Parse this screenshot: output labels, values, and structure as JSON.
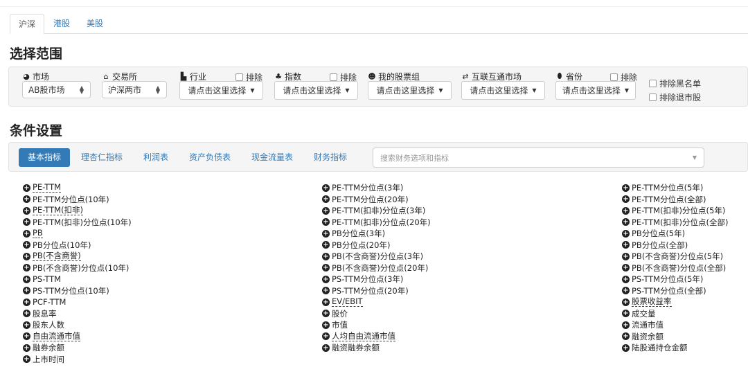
{
  "market_tabs": [
    {
      "label": "沪深",
      "active": true
    },
    {
      "label": "港股",
      "active": false
    },
    {
      "label": "美股",
      "active": false
    }
  ],
  "scope": {
    "title": "选择范围",
    "market": {
      "label": "市场",
      "icon": "globe-icon",
      "value": "AB股市场"
    },
    "exchange": {
      "label": "交易所",
      "icon": "bank-icon",
      "value": "沪深两市"
    },
    "industry": {
      "label": "行业",
      "icon": "factory-icon",
      "exclude": "排除",
      "button": "请点击这里选择"
    },
    "index": {
      "label": "指数",
      "icon": "cubes-icon",
      "exclude": "排除",
      "button": "请点击这里选择"
    },
    "portfolio": {
      "label": "我的股票组",
      "icon": "users-icon",
      "button": "请点击这里选择"
    },
    "connect": {
      "label": "互联互通市场",
      "icon": "exchange-icon",
      "button": "请点击这里选择"
    },
    "province": {
      "label": "省份",
      "icon": "map-marker-icon",
      "exclude": "排除",
      "button": "请点击这里选择"
    },
    "blacklist": "排除黑名单",
    "delisted": "排除退市股"
  },
  "conditions": {
    "title": "条件设置",
    "tabs": [
      {
        "label": "基本指标",
        "active": true
      },
      {
        "label": "理杏仁指标",
        "active": false
      },
      {
        "label": "利润表",
        "active": false
      },
      {
        "label": "资产负债表",
        "active": false
      },
      {
        "label": "现金流量表",
        "active": false
      },
      {
        "label": "财务指标",
        "active": false
      }
    ],
    "search_placeholder": "搜索财务选项和指标"
  },
  "indicators": {
    "col1": [
      {
        "label": "PE-TTM",
        "u": true
      },
      {
        "label": "PE-TTM分位点(10年)",
        "u": false
      },
      {
        "label": "PE-TTM(扣非)",
        "u": true
      },
      {
        "label": "PE-TTM(扣非)分位点(10年)",
        "u": false
      },
      {
        "label": "PB",
        "u": true
      },
      {
        "label": "PB分位点(10年)",
        "u": false
      },
      {
        "label": "PB(不含商誉)",
        "u": true
      },
      {
        "label": "PB(不含商誉)分位点(10年)",
        "u": false
      },
      {
        "label": "PS-TTM",
        "u": false
      },
      {
        "label": "PS-TTM分位点(10年)",
        "u": false
      },
      {
        "label": "PCF-TTM",
        "u": false
      },
      {
        "label": "股息率",
        "u": false
      },
      {
        "label": "股东人数",
        "u": false
      },
      {
        "label": "自由流通市值",
        "u": true
      },
      {
        "label": "融券余额",
        "u": false
      },
      {
        "label": "上市时间",
        "u": false
      }
    ],
    "col2": [
      {
        "label": "PE-TTM分位点(3年)",
        "u": false
      },
      {
        "label": "PE-TTM分位点(20年)",
        "u": false
      },
      {
        "label": "PE-TTM(扣非)分位点(3年)",
        "u": false
      },
      {
        "label": "PE-TTM(扣非)分位点(20年)",
        "u": false
      },
      {
        "label": "PB分位点(3年)",
        "u": false
      },
      {
        "label": "PB分位点(20年)",
        "u": false
      },
      {
        "label": "PB(不含商誉)分位点(3年)",
        "u": false
      },
      {
        "label": "PB(不含商誉)分位点(20年)",
        "u": false
      },
      {
        "label": "PS-TTM分位点(3年)",
        "u": false
      },
      {
        "label": "PS-TTM分位点(20年)",
        "u": false
      },
      {
        "label": "EV/EBIT",
        "u": true
      },
      {
        "label": "股价",
        "u": false
      },
      {
        "label": "市值",
        "u": false
      },
      {
        "label": "人均自由流通市值",
        "u": true
      },
      {
        "label": "融资融券余额",
        "u": false
      }
    ],
    "col3": [
      {
        "label": "PE-TTM分位点(5年)",
        "u": false
      },
      {
        "label": "PE-TTM分位点(全部)",
        "u": false
      },
      {
        "label": "PE-TTM(扣非)分位点(5年)",
        "u": false
      },
      {
        "label": "PE-TTM(扣非)分位点(全部)",
        "u": false
      },
      {
        "label": "PB分位点(5年)",
        "u": false
      },
      {
        "label": "PB分位点(全部)",
        "u": false
      },
      {
        "label": "PB(不含商誉)分位点(5年)",
        "u": false
      },
      {
        "label": "PB(不含商誉)分位点(全部)",
        "u": false
      },
      {
        "label": "PS-TTM分位点(5年)",
        "u": false
      },
      {
        "label": "PS-TTM分位点(全部)",
        "u": false
      },
      {
        "label": "股票收益率",
        "u": true
      },
      {
        "label": "成交量",
        "u": false
      },
      {
        "label": "流通市值",
        "u": false
      },
      {
        "label": "融资余额",
        "u": false
      },
      {
        "label": "陆股通持仓金额",
        "u": false
      }
    ]
  }
}
